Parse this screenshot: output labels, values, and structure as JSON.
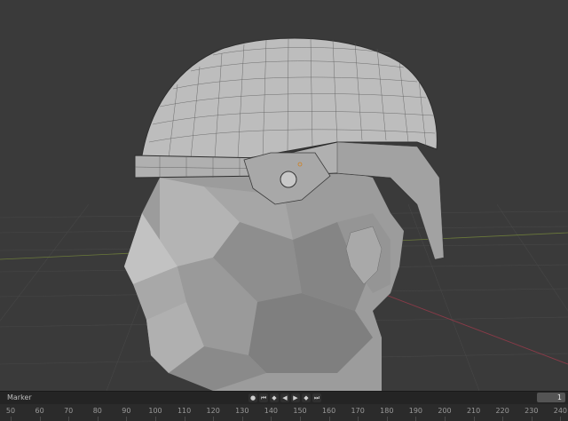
{
  "viewport": {
    "background": "#3a3a3a",
    "object": "head-with-helmet-mesh"
  },
  "timeline": {
    "marker_label": "Marker",
    "current_frame": "1",
    "transport": [
      {
        "name": "keyframe-dot-button",
        "glyph": "●"
      },
      {
        "name": "jump-start-button",
        "glyph": "⏮"
      },
      {
        "name": "prev-keyframe-button",
        "glyph": "◆"
      },
      {
        "name": "play-reverse-button",
        "glyph": "◀"
      },
      {
        "name": "play-button",
        "glyph": "▶"
      },
      {
        "name": "next-keyframe-button",
        "glyph": "◆"
      },
      {
        "name": "jump-end-button",
        "glyph": "⏭"
      }
    ],
    "ruler": [
      "50",
      "60",
      "70",
      "80",
      "90",
      "100",
      "110",
      "120",
      "130",
      "140",
      "150",
      "160",
      "170",
      "180",
      "190",
      "200",
      "210",
      "220",
      "230",
      "240"
    ]
  }
}
